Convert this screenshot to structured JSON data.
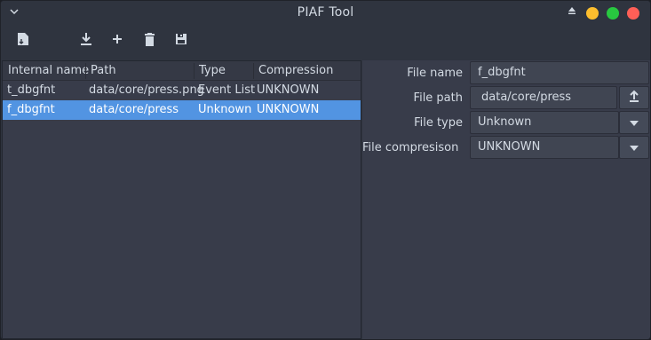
{
  "window": {
    "title": "PIAF Tool",
    "controls": [
      {
        "name": "minimize",
        "color": "#fdbe2e"
      },
      {
        "name": "maximize",
        "color": "#28c840"
      },
      {
        "name": "close",
        "color": "#ff5f57"
      }
    ]
  },
  "toolbar": {
    "buttons": [
      "new-file-icon",
      "download-icon",
      "add-icon",
      "delete-icon",
      "save-icon"
    ]
  },
  "table": {
    "headers": [
      "Internal name",
      "Path",
      "Type",
      "Compression"
    ],
    "rows": [
      {
        "name": "t_dbgfnt",
        "path": "data/core/press.png",
        "type": "Event List",
        "compression": "UNKNOWN",
        "selected": false
      },
      {
        "name": "f_dbgfnt",
        "path": "data/core/press",
        "type": "Unknown",
        "compression": "UNKNOWN",
        "selected": true
      }
    ]
  },
  "details": {
    "file_name_label": "File name",
    "file_name_value": "f_dbgfnt",
    "file_path_label": "File path",
    "file_path_value": "data/core/press",
    "file_type_label": "File type",
    "file_type_value": "Unknown",
    "file_compression_label": "File compresison",
    "file_compression_value": "UNKNOWN"
  },
  "colors": {
    "accent": "#5294e2",
    "background": "#383c4a",
    "chrome": "#2f343f"
  }
}
